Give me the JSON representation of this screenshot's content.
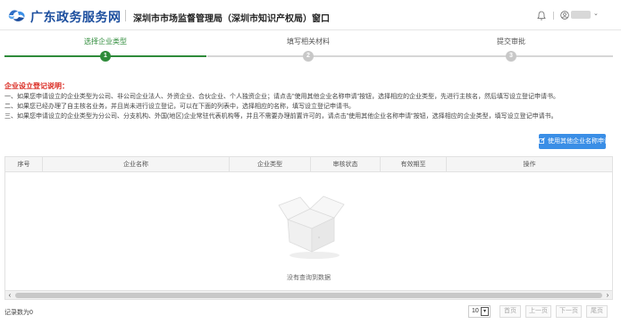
{
  "header": {
    "brand": "广东政务服务网",
    "window_title": "深圳市市场监督管理局（深圳市知识产权局）窗口",
    "user_caret": "⌄",
    "icons": [
      "logo-icon",
      "bell-icon",
      "user-icon"
    ]
  },
  "steps": [
    {
      "label": "选择企业类型",
      "number": "1",
      "state": "active"
    },
    {
      "label": "填写相关材料",
      "number": "2",
      "state": "inactive"
    },
    {
      "label": "提交审批",
      "number": "3",
      "state": "inactive"
    }
  ],
  "notice": {
    "title": "企业设立登记说明：",
    "lines": [
      "一、如果您申请设立的企业类型为公司、非公司企业法人、外资企业、合伙企业、个人独资企业；请点击\"使用其他企业名称申请\"按钮，选择相应的企业类型，先进行主核名，然后填写设立登记申请书。",
      "二、如果您已经办理了自主核名业务，并且尚未进行设立登记，可以在下面的列表中，选择相应的名称，填写设立登记申请书。",
      "三、如果您申请设立的企业类型为分公司、分支机构、外国(地区)企业常驻代表机构等，并且不需要办理前置许可的，请点击\"使用其他企业名称申请\"按钮，选择相应的企业类型，填写设立登记申请书。"
    ]
  },
  "actions": {
    "use_other_name": "使用其他企业名称申请",
    "use_other_name_icon": "edit-icon"
  },
  "table": {
    "columns": [
      "序号",
      "企业名称",
      "企业类型",
      "审核状态",
      "有效期至",
      "操作"
    ],
    "rows": [],
    "empty_text": "没有查询到数据"
  },
  "scrollbar": {
    "left": "‹",
    "right": "›"
  },
  "footer": {
    "record_count": "记录数为0",
    "page_size": "10",
    "page_size_caret": "▾",
    "first": "首页",
    "prev": "上一页",
    "next": "下一页",
    "last": "尾页"
  },
  "colors": {
    "accent_green": "#2e8b3a",
    "brand_blue": "#1c4e9e",
    "button_blue": "#3a8ee6",
    "notice_red": "#d9251c"
  }
}
